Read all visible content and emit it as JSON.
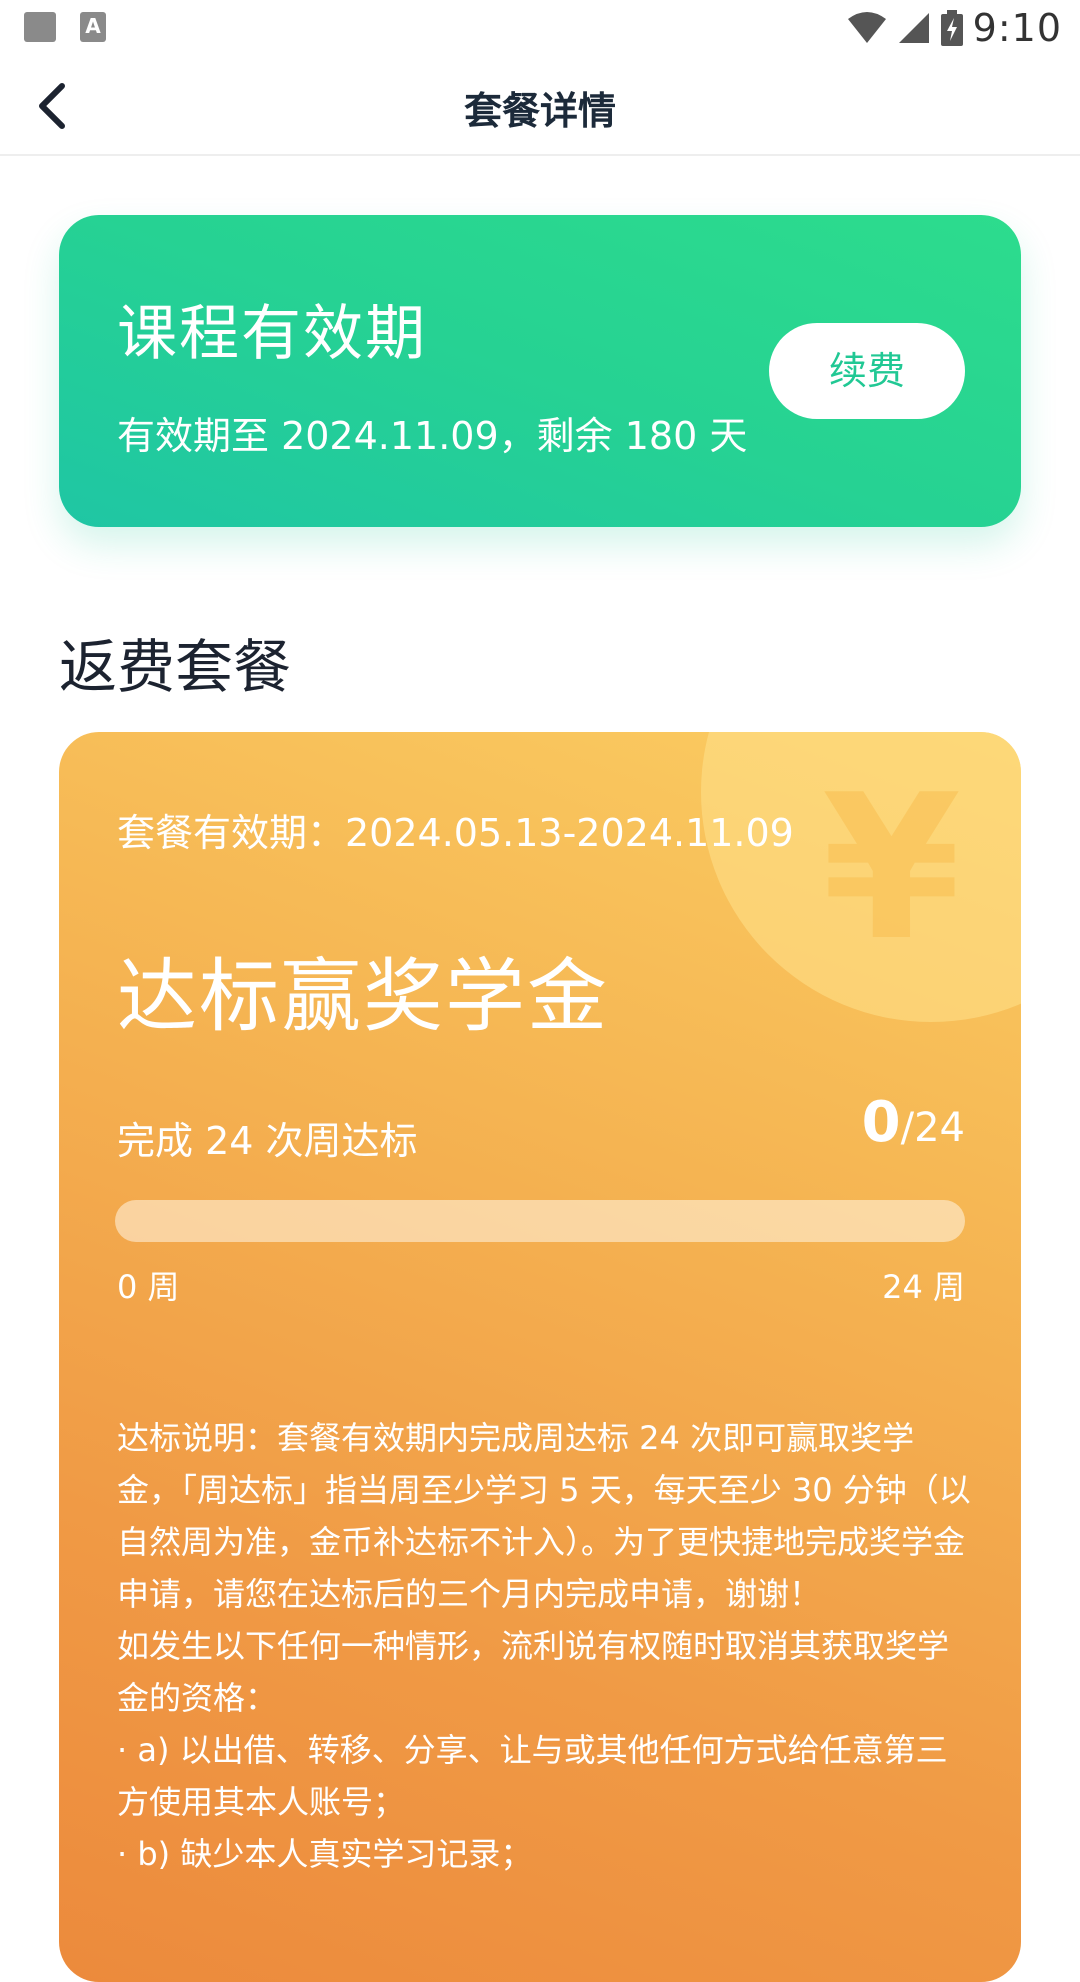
{
  "status_bar": {
    "time": "9:10",
    "a_badge": "A"
  },
  "header": {
    "title": "套餐详情"
  },
  "validity": {
    "title": "课程有效期",
    "subtitle": "有效期至 2024.11.09，剩余 180 天",
    "renew_label": "续费"
  },
  "section": {
    "title": "返费套餐"
  },
  "plan": {
    "period": "套餐有效期：2024.05.13-2024.11.09",
    "name": "达标赢奖学金",
    "goal": "完成 24 次周达标",
    "progress_current": "0",
    "progress_total": "/24",
    "progress_fraction": 0,
    "week_start": "0 周",
    "week_end": "24 周",
    "yen_symbol": "¥",
    "description_lines": [
      "达标说明：套餐有效期内完成周达标 24 次即可赢取奖学金，「周达标」指当周至少学习 5 天，每天至少 30 分钟（以自然周为准，金币补达标不计入）。为了更快捷地完成奖学金申请，请您在达标后的三个月内完成申请，谢谢！",
      "如发生以下任何一种情形，流利说有权随时取消其获取奖学金的资格：",
      "· a) 以出借、转移、分享、让与或其他任何方式给任意第三方使用其本人账号；",
      "· b) 缺少本人真实学习记录；"
    ]
  },
  "colors": {
    "validity_card": "#26d293",
    "renew_text": "#21c894",
    "plan_card": "#f5b452",
    "title_text": "#1c2330"
  }
}
